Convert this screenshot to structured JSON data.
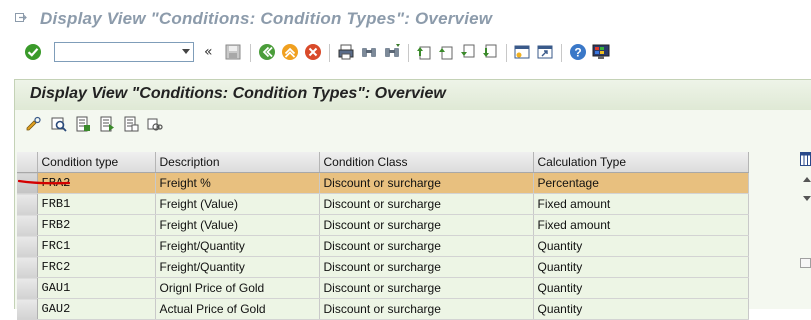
{
  "window": {
    "title": "Display View \"Conditions: Condition Types\": Overview"
  },
  "toolbar": {
    "command_field": {
      "value": "",
      "placeholder": ""
    },
    "collapse_label": "«",
    "icons": [
      "enter-icon",
      "save-icon",
      "back-icon",
      "exit-icon",
      "cancel-icon",
      "print-icon",
      "find-icon",
      "find-next-icon",
      "first-page-icon",
      "previous-page-icon",
      "next-page-icon",
      "last-page-icon",
      "create-session-icon",
      "shortcut-icon",
      "help-icon",
      "customize-layout-icon"
    ]
  },
  "screen": {
    "title": "Display View \"Conditions: Condition Types\": Overview"
  },
  "app_toolbar": {
    "icons": [
      "display-change-icon",
      "details-icon",
      "select-all-icon",
      "select-block-icon",
      "deselect-all-icon",
      "print-standard-list-icon"
    ]
  },
  "table": {
    "columns": [
      "Condition type",
      "Description",
      "Condition Class",
      "Calculation Type"
    ],
    "rows": [
      {
        "code": "FRA2",
        "description": "Freight %",
        "class": "Discount or surcharge",
        "calc": "Percentage",
        "selected": true
      },
      {
        "code": "FRB1",
        "description": "Freight (Value)",
        "class": "Discount or surcharge",
        "calc": "Fixed amount"
      },
      {
        "code": "FRB2",
        "description": "Freight (Value)",
        "class": "Discount or surcharge",
        "calc": "Fixed amount"
      },
      {
        "code": "FRC1",
        "description": "Freight/Quantity",
        "class": "Discount or surcharge",
        "calc": "Quantity"
      },
      {
        "code": "FRC2",
        "description": "Freight/Quantity",
        "class": "Discount or surcharge",
        "calc": "Quantity"
      },
      {
        "code": "GAU1",
        "description": "Orignl Price of Gold",
        "class": "Discount or surcharge",
        "calc": "Quantity"
      },
      {
        "code": "GAU2",
        "description": "Actual Price of Gold",
        "class": "Discount or surcharge",
        "calc": "Quantity"
      }
    ]
  },
  "colors": {
    "selected_row": "#e8c07f",
    "row_bg": "#edf5e5",
    "header_bg": "#dfe9d5",
    "annotation": "#d40000"
  }
}
